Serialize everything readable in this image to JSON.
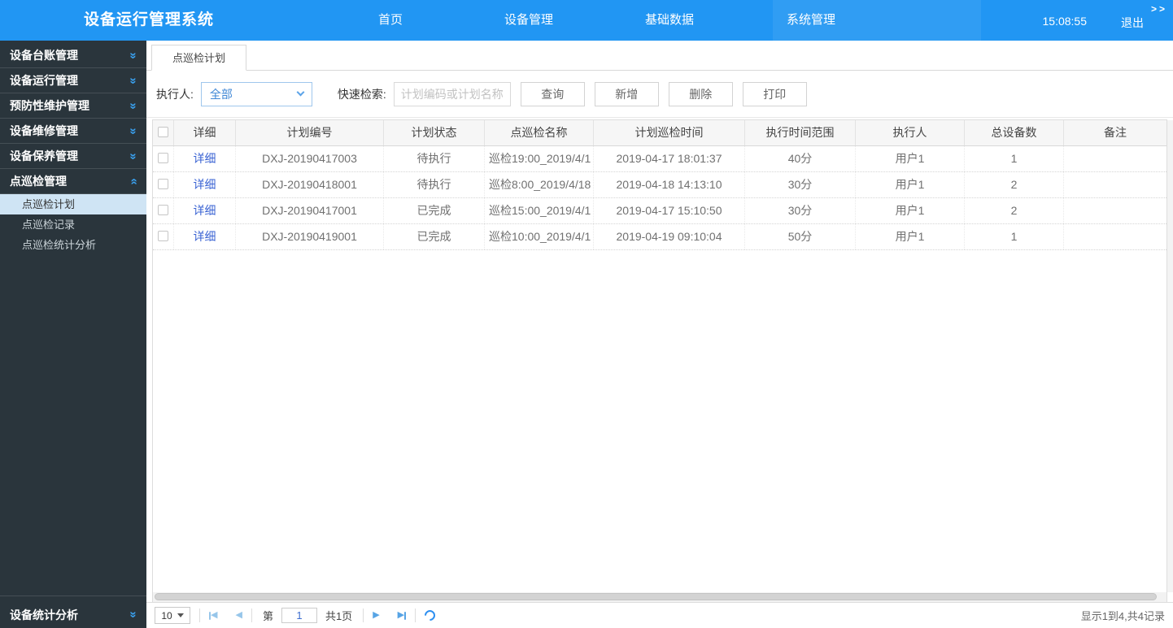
{
  "colors": {
    "topbar_blue": "#2196f3",
    "sidebar_dark": "#2a353c",
    "selected_item_bg": "#cfe4f4",
    "link_blue": "#3a63d3",
    "accent_blue": "#3aa0ee"
  },
  "topbar": {
    "title": "设备运行管理系统",
    "nav": [
      {
        "label": "首页"
      },
      {
        "label": "设备管理"
      },
      {
        "label": "基础数据"
      },
      {
        "label": "系统管理"
      }
    ],
    "time": "15:08:55",
    "logout": "退出",
    "collapse": ">>"
  },
  "sidebar": {
    "groups": [
      {
        "label": "设备台账管理"
      },
      {
        "label": "设备运行管理"
      },
      {
        "label": "预防性维护管理"
      },
      {
        "label": "设备维修管理"
      },
      {
        "label": "设备保养管理"
      },
      {
        "label": "点巡检管理",
        "children": [
          {
            "label": "点巡检计划",
            "selected": true
          },
          {
            "label": "点巡检记录"
          },
          {
            "label": "点巡检统计分析"
          }
        ]
      }
    ],
    "bottom_item": {
      "label": "设备统计分析"
    }
  },
  "tabs": {
    "active": "点巡检计划"
  },
  "filters": {
    "executor_label": "执行人:",
    "executor_value": "全部",
    "search_label": "快速检索:",
    "search_placeholder": "计划编码或计划名称",
    "buttons": [
      {
        "label": "查询"
      },
      {
        "label": "新增"
      },
      {
        "label": "删除"
      },
      {
        "label": "打印"
      }
    ]
  },
  "table": {
    "detail_link": "详细",
    "columns": [
      "详细",
      "计划编号",
      "计划状态",
      "点巡检名称",
      "计划巡检时间",
      "执行时间范围",
      "执行人",
      "总设备数",
      "备注"
    ],
    "rows": [
      {
        "plan_no": "DXJ-20190417003",
        "status": "待执行",
        "name": "巡检19:00_2019/4/1",
        "time": "2019-04-17 18:01:37",
        "range": "40分",
        "executor": "用户1",
        "count": "1",
        "remark": ""
      },
      {
        "plan_no": "DXJ-20190418001",
        "status": "待执行",
        "name": "巡检8:00_2019/4/18",
        "time": "2019-04-18 14:13:10",
        "range": "30分",
        "executor": "用户1",
        "count": "2",
        "remark": ""
      },
      {
        "plan_no": "DXJ-20190417001",
        "status": "已完成",
        "name": "巡检15:00_2019/4/1",
        "time": "2019-04-17 15:10:50",
        "range": "30分",
        "executor": "用户1",
        "count": "2",
        "remark": ""
      },
      {
        "plan_no": "DXJ-20190419001",
        "status": "已完成",
        "name": "巡检10:00_2019/4/1",
        "time": "2019-04-19 09:10:04",
        "range": "50分",
        "executor": "用户1",
        "count": "1",
        "remark": ""
      }
    ]
  },
  "pagination": {
    "page_size": "10",
    "page_prefix": "第",
    "page_value": "1",
    "total_pages": "共1页",
    "summary": "显示1到4,共4记录"
  },
  "icons": {
    "double_chevron": "»",
    "prev_triangle": "◀",
    "next_triangle": "▶"
  }
}
